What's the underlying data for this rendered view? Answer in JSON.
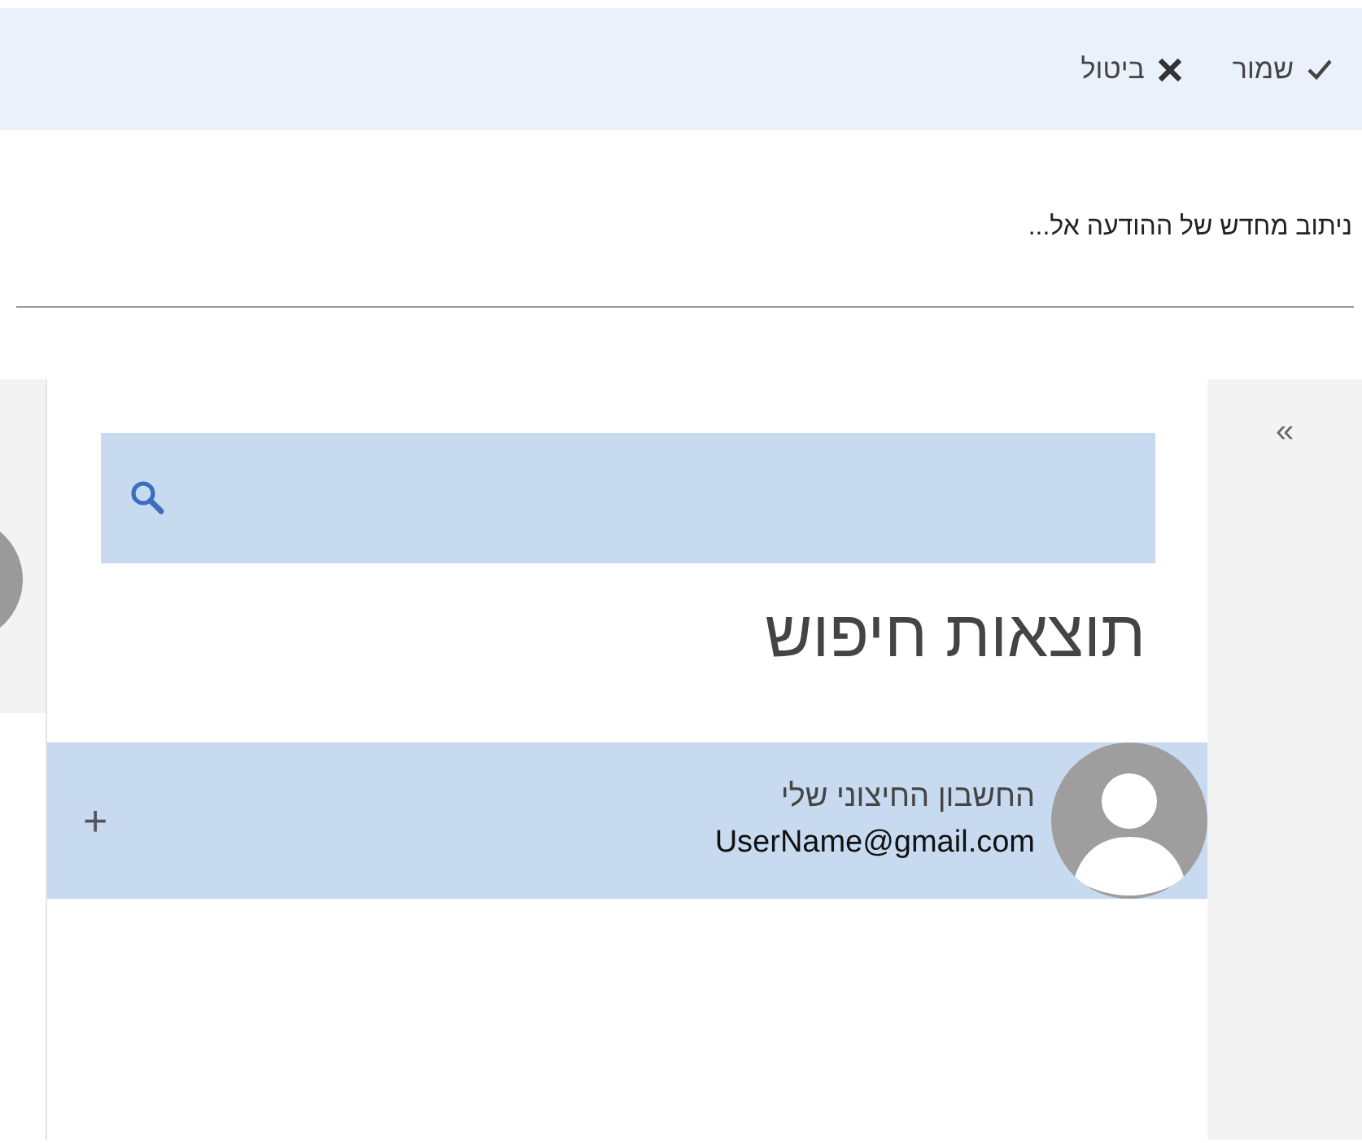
{
  "toolbar": {
    "buttons": [
      {
        "kind": "save",
        "label": "שמור"
      },
      {
        "kind": "cancel",
        "label": "ביטול"
      }
    ]
  },
  "subject": "ניתוב מחדש של ההודעה אל...",
  "collapse_button": {
    "label": "«"
  },
  "results": {
    "heading": "תוצאות חיפוש",
    "items": [
      {
        "name": "החשבון החיצוני שלי",
        "email": "UserName@gmail.com",
        "selected": true,
        "add_label": "+"
      }
    ]
  }
}
